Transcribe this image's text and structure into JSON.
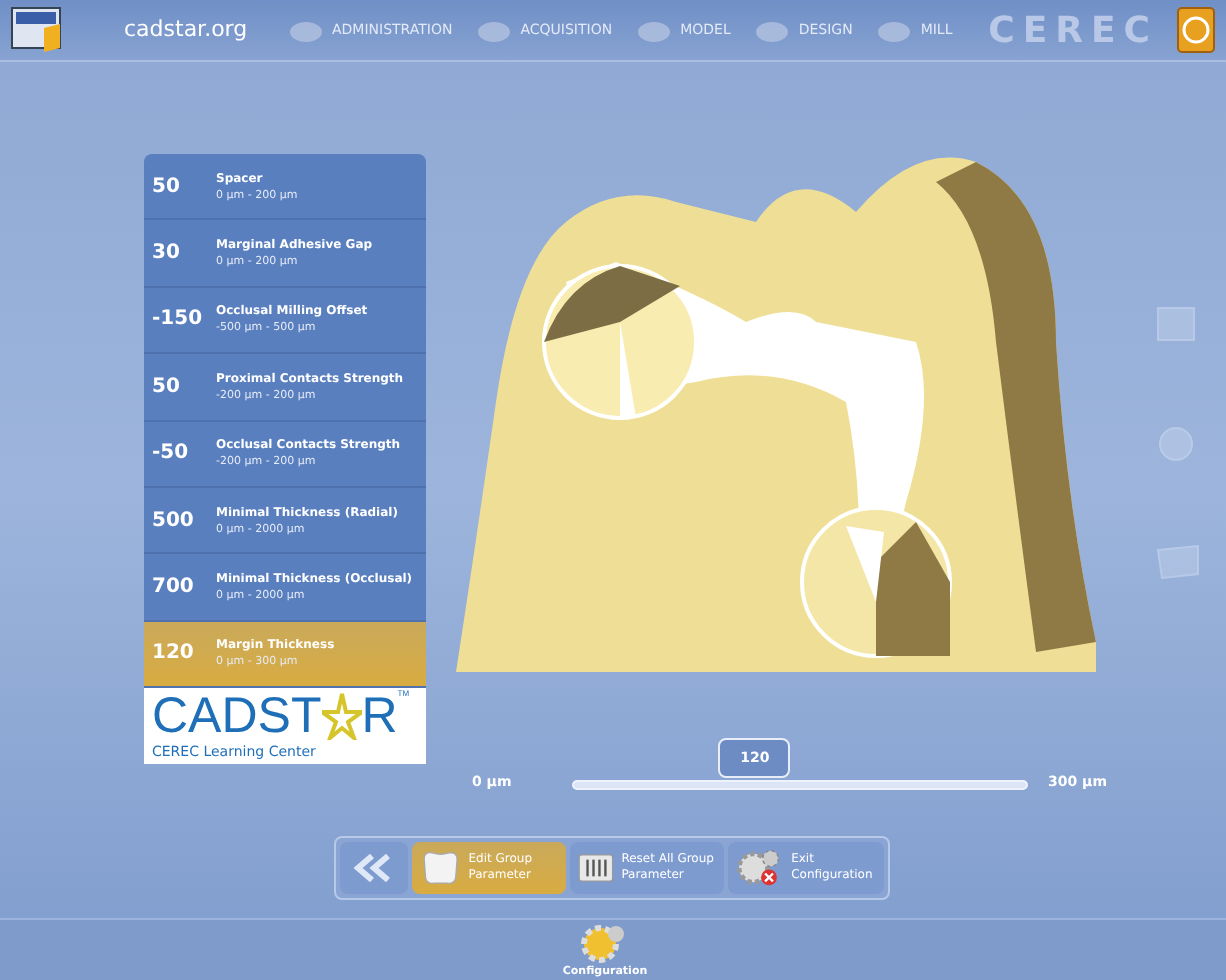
{
  "header": {
    "site": "cadstar.org",
    "steps": [
      {
        "label": "ADMINISTRATION",
        "selected": false
      },
      {
        "label": "ACQUISITION",
        "selected": false
      },
      {
        "label": "MODEL",
        "selected": false
      },
      {
        "label": "DESIGN",
        "selected": false
      },
      {
        "label": "MILL",
        "selected": false
      }
    ],
    "brand": "CEREC"
  },
  "parameters": [
    {
      "value": "50",
      "name": "Spacer",
      "range": "0 µm - 200 µm",
      "selected": false
    },
    {
      "value": "30",
      "name": "Marginal Adhesive Gap",
      "range": "0 µm - 200 µm",
      "selected": false
    },
    {
      "value": "-150",
      "name": "Occlusal Milling Offset",
      "range": "-500 µm - 500 µm",
      "selected": false
    },
    {
      "value": "50",
      "name": "Proximal Contacts Strength",
      "range": "-200 µm - 200 µm",
      "selected": false
    },
    {
      "value": "-50",
      "name": "Occlusal Contacts Strength",
      "range": "-200 µm - 200 µm",
      "selected": false
    },
    {
      "value": "500",
      "name": "Minimal Thickness (Radial)",
      "range": "0 µm - 2000 µm",
      "selected": false
    },
    {
      "value": "700",
      "name": "Minimal Thickness (Occlusal)",
      "range": "0 µm - 2000 µm",
      "selected": false
    },
    {
      "value": "120",
      "name": "Margin Thickness",
      "range": "0 µm - 300 µm",
      "selected": true
    }
  ],
  "logo": {
    "wordmark_left": "CADST",
    "wordmark_right": "R",
    "trademark": "TM",
    "tagline": "CEREC Learning Center"
  },
  "slider": {
    "min_label": "0 µm",
    "max_label": "300 µm",
    "value": "120",
    "level": 0.4
  },
  "toolbar": [
    {
      "kind": "back",
      "selected": false
    },
    {
      "kind": "edit",
      "label": "Edit Group Parameter",
      "selected": true
    },
    {
      "kind": "reset",
      "label": "Reset All Group Parameter",
      "selected": false
    },
    {
      "kind": "exit",
      "label": "Exit Configuration",
      "selected": false
    }
  ],
  "bottom": {
    "label": "Configuration"
  }
}
